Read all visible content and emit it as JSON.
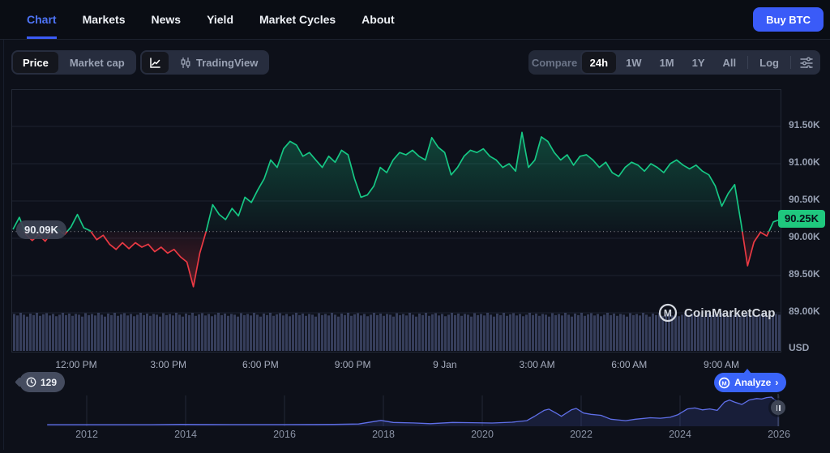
{
  "nav": {
    "items": [
      {
        "label": "Chart",
        "active": true
      },
      {
        "label": "Markets",
        "active": false
      },
      {
        "label": "News",
        "active": false
      },
      {
        "label": "Yield",
        "active": false
      },
      {
        "label": "Market Cycles",
        "active": false
      },
      {
        "label": "About",
        "active": false
      }
    ],
    "buy_button_label": "Buy BTC"
  },
  "toolbar": {
    "view_toggle": {
      "options": [
        "Price",
        "Market cap"
      ],
      "active": "Price"
    },
    "tradingview_label": "TradingView",
    "compare_label": "Compare",
    "range": {
      "options": [
        "24h",
        "1W",
        "1M",
        "1Y",
        "All"
      ],
      "active": "24h",
      "log_label": "Log"
    }
  },
  "price_axis": {
    "unit_label": "USD",
    "open_label": "90.09K",
    "last_label": "90.25K"
  },
  "footer": {
    "history_count": "129",
    "analyze_label": "Analyze",
    "analyze_arrow": "›",
    "watermark": "CoinMarketCap"
  },
  "colors": {
    "up": "#16c784",
    "down": "#ea3943",
    "accent": "#3a5bf8",
    "navline": "#5f6fe8"
  },
  "chart_data": [
    {
      "type": "area",
      "title": "BTC/USD price, 24h",
      "ylabel": "USD",
      "ylim": [
        88.48,
        91.99
      ],
      "baseline_value": 90.09,
      "last_value": 90.25,
      "x_tick_labels": [
        "12:00 PM",
        "3:00 PM",
        "6:00 PM",
        "9:00 PM",
        "9 Jan",
        "3:00 AM",
        "6:00 AM",
        "9:00 AM"
      ],
      "y_ticks": [
        {
          "value": 91.5,
          "label": "91.50K"
        },
        {
          "value": 91.0,
          "label": "91.00K"
        },
        {
          "value": 90.5,
          "label": "90.50K"
        },
        {
          "value": 90.0,
          "label": "90.00K"
        },
        {
          "value": 89.5,
          "label": "89.50K"
        },
        {
          "value": 89.0,
          "label": "89.00K"
        }
      ],
      "prices_k": [
        90.12,
        90.28,
        90.05,
        89.97,
        90.05,
        89.96,
        90.08,
        90.12,
        90.05,
        90.15,
        90.32,
        90.14,
        90.1,
        89.98,
        90.04,
        89.92,
        89.85,
        89.94,
        89.86,
        89.94,
        89.88,
        89.92,
        89.82,
        89.88,
        89.8,
        89.85,
        89.75,
        89.68,
        89.35,
        89.8,
        90.1,
        90.45,
        90.32,
        90.25,
        90.4,
        90.3,
        90.55,
        90.48,
        90.65,
        90.8,
        91.05,
        90.95,
        91.2,
        91.3,
        91.25,
        91.1,
        91.15,
        91.05,
        90.95,
        91.1,
        91.02,
        91.18,
        91.12,
        90.8,
        90.55,
        90.58,
        90.7,
        90.95,
        90.88,
        91.05,
        91.15,
        91.12,
        91.18,
        91.1,
        91.05,
        91.35,
        91.22,
        91.15,
        90.85,
        90.95,
        91.1,
        91.18,
        91.15,
        91.2,
        91.1,
        91.05,
        90.95,
        91.0,
        90.9,
        91.42,
        90.95,
        91.05,
        91.36,
        91.3,
        91.15,
        91.05,
        91.12,
        90.98,
        91.1,
        91.12,
        91.05,
        90.95,
        91.02,
        90.88,
        90.83,
        90.95,
        91.02,
        90.98,
        90.9,
        91.0,
        90.95,
        90.88,
        91.0,
        91.05,
        90.98,
        90.93,
        90.98,
        90.9,
        90.85,
        90.7,
        90.43,
        90.6,
        90.72,
        90.2,
        89.63,
        89.95,
        90.08,
        90.03,
        90.22,
        90.25
      ],
      "volume_profile": [
        0.97,
        0.93,
        1.0,
        0.95,
        0.9,
        0.98,
        0.94,
        1.0,
        0.92,
        0.96,
        0.99,
        0.93,
        0.97,
        0.91,
        0.95,
        1.0,
        0.94,
        0.98,
        0.92,
        0.97,
        0.95,
        0.9,
        0.99,
        0.94
      ]
    },
    {
      "type": "line",
      "title": "BTC price all-time navigator",
      "x_tick_labels": [
        "2012",
        "2014",
        "2016",
        "2018",
        "2020",
        "2022",
        "2024",
        "2026"
      ],
      "points": [
        [
          2011.2,
          0
        ],
        [
          2012,
          0.005
        ],
        [
          2012.8,
          0.01
        ],
        [
          2013.3,
          0.06
        ],
        [
          2013.9,
          0.9
        ],
        [
          2014.3,
          0.5
        ],
        [
          2014.9,
          0.3
        ],
        [
          2015.5,
          0.25
        ],
        [
          2016,
          0.45
        ],
        [
          2016.6,
          0.7
        ],
        [
          2017,
          1.1
        ],
        [
          2017.5,
          2.5
        ],
        [
          2017.95,
          17
        ],
        [
          2018.2,
          9
        ],
        [
          2018.6,
          7
        ],
        [
          2018.95,
          3.8
        ],
        [
          2019.4,
          9
        ],
        [
          2019.8,
          8
        ],
        [
          2020.2,
          6.5
        ],
        [
          2020.6,
          10
        ],
        [
          2020.9,
          16
        ],
        [
          2021.05,
          33
        ],
        [
          2021.25,
          58
        ],
        [
          2021.35,
          63
        ],
        [
          2021.5,
          46
        ],
        [
          2021.6,
          34
        ],
        [
          2021.8,
          60
        ],
        [
          2021.9,
          66
        ],
        [
          2022.05,
          47
        ],
        [
          2022.2,
          42
        ],
        [
          2022.4,
          38
        ],
        [
          2022.6,
          22
        ],
        [
          2022.9,
          16
        ],
        [
          2023.1,
          22
        ],
        [
          2023.4,
          28
        ],
        [
          2023.6,
          26
        ],
        [
          2023.8,
          30
        ],
        [
          2023.95,
          40
        ],
        [
          2024.15,
          64
        ],
        [
          2024.3,
          68
        ],
        [
          2024.45,
          60
        ],
        [
          2024.6,
          64
        ],
        [
          2024.75,
          58
        ],
        [
          2024.9,
          92
        ],
        [
          2025.0,
          100
        ],
        [
          2025.1,
          92
        ],
        [
          2025.25,
          82
        ],
        [
          2025.4,
          100
        ],
        [
          2025.55,
          106
        ],
        [
          2025.65,
          104
        ],
        [
          2025.75,
          110
        ],
        [
          2025.85,
          112
        ],
        [
          2025.92,
          100
        ],
        [
          2026.0,
          92
        ]
      ]
    }
  ]
}
